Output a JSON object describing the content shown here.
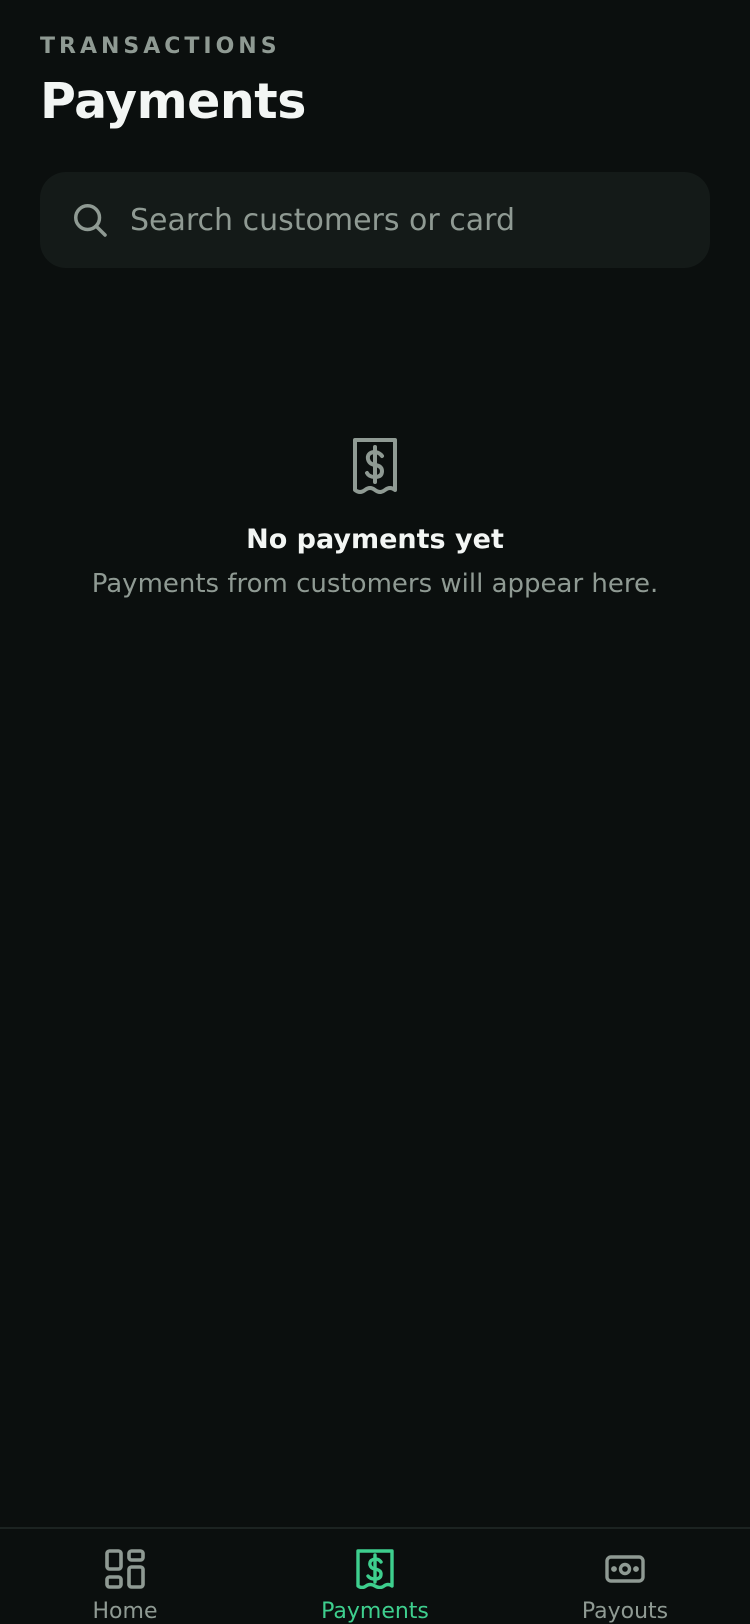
{
  "header": {
    "eyebrow": "TRANSACTIONS",
    "title": "Payments"
  },
  "search": {
    "placeholder": "Search customers or card",
    "value": ""
  },
  "empty_state": {
    "icon": "receipt-dollar-icon",
    "title": "No payments yet",
    "subtitle": "Payments from customers will appear here."
  },
  "tabbar": {
    "active": "payments",
    "items": [
      {
        "id": "home",
        "label": "Home",
        "icon": "grid-icon"
      },
      {
        "id": "payments",
        "label": "Payments",
        "icon": "receipt-dollar-icon"
      },
      {
        "id": "payouts",
        "label": "Payouts",
        "icon": "banknote-icon"
      }
    ]
  },
  "colors": {
    "background": "#0b0f0e",
    "surface": "#141a18",
    "text_primary": "#f3f6f4",
    "text_muted": "#8f9a93",
    "accent": "#3ecf8e"
  }
}
